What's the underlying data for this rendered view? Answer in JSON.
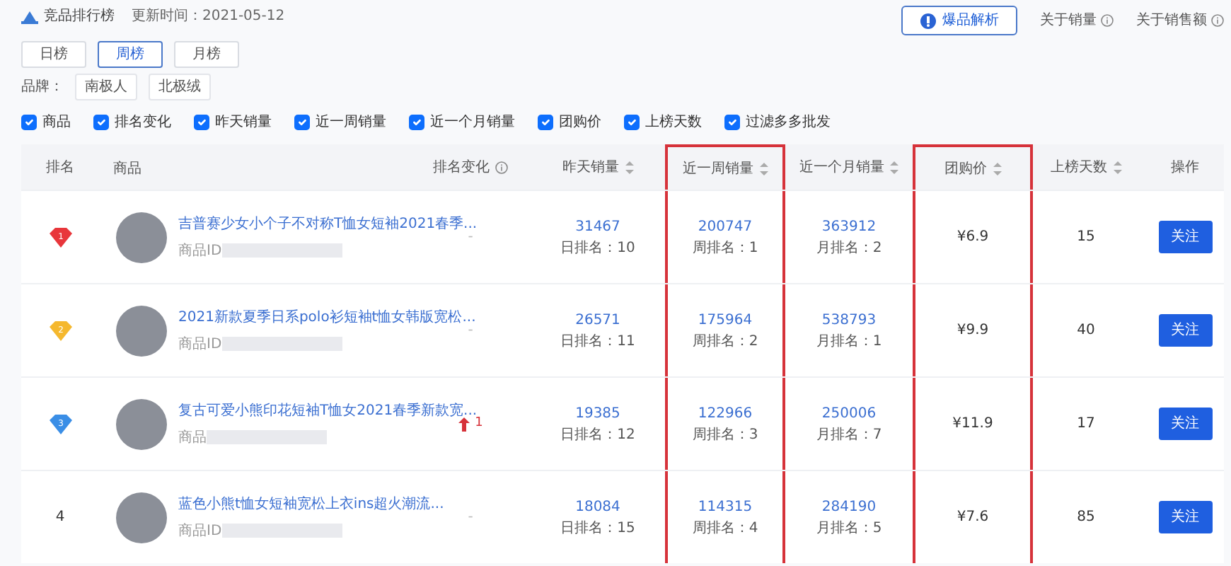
{
  "header": {
    "title": "竞品排行榜",
    "update_time": "更新时间：2021-05-12",
    "analysis_button": "爆品解析",
    "help_links": [
      "关于销量",
      "关于销售额"
    ]
  },
  "period_tabs": [
    {
      "label": "日榜",
      "selected": false
    },
    {
      "label": "周榜",
      "selected": true
    },
    {
      "label": "月榜",
      "selected": false
    }
  ],
  "brand_filter": {
    "label": "品牌：",
    "brands": [
      "南极人",
      "北极绒"
    ]
  },
  "column_toggles": [
    {
      "label": "商品",
      "checked": true
    },
    {
      "label": "排名变化",
      "checked": true
    },
    {
      "label": "昨天销量",
      "checked": true
    },
    {
      "label": "近一周销量",
      "checked": true
    },
    {
      "label": "近一个月销量",
      "checked": true
    },
    {
      "label": "团购价",
      "checked": true
    },
    {
      "label": "上榜天数",
      "checked": true
    },
    {
      "label": "过滤多多批发",
      "checked": true
    }
  ],
  "table": {
    "columns": [
      {
        "label": "排名",
        "sortable": false,
        "info": false,
        "highlighted": false
      },
      {
        "label": "商品",
        "sortable": false,
        "info": false,
        "highlighted": false
      },
      {
        "label": "排名变化",
        "sortable": false,
        "info": true,
        "highlighted": false
      },
      {
        "label": "昨天销量",
        "sortable": true,
        "info": false,
        "highlighted": false
      },
      {
        "label": "近一周销量",
        "sortable": true,
        "info": false,
        "highlighted": true
      },
      {
        "label": "近一个月销量",
        "sortable": true,
        "info": false,
        "highlighted": false
      },
      {
        "label": "团购价",
        "sortable": true,
        "info": false,
        "highlighted": true
      },
      {
        "label": "上榜天数",
        "sortable": true,
        "info": false,
        "highlighted": false
      },
      {
        "label": "操作",
        "sortable": false,
        "info": false,
        "highlighted": false
      }
    ],
    "rows": [
      {
        "rank": {
          "kind": "medal",
          "text": "1",
          "color": "#e8363b"
        },
        "title": "吉普赛少女小个子不对称T恤女短袖2021春季...",
        "store": "商品ID",
        "rank_change": {
          "kind": "none",
          "text": "-"
        },
        "yesterday": "31467",
        "day_rank": "日排名：10",
        "week": "200747",
        "week_rank": "周排名：1",
        "month": "363912",
        "month_rank": "月排名：2",
        "price": "¥6.9",
        "days": "15",
        "action": "关注"
      },
      {
        "rank": {
          "kind": "medal",
          "text": "2",
          "color": "#f5b82e"
        },
        "title": "2021新款夏季日系polo衫短袖t恤女韩版宽松...",
        "store": "商品ID",
        "rank_change": {
          "kind": "none",
          "text": "-"
        },
        "yesterday": "26571",
        "day_rank": "日排名：11",
        "week": "175964",
        "week_rank": "周排名：2",
        "month": "538793",
        "month_rank": "月排名：1",
        "price": "¥9.9",
        "days": "40",
        "action": "关注"
      },
      {
        "rank": {
          "kind": "medal",
          "text": "3",
          "color": "#3a8ee6"
        },
        "title": "复古可爱小熊印花短袖T恤女2021春季新款宽...",
        "store": "商品",
        "rank_change": {
          "kind": "up",
          "text": "1"
        },
        "yesterday": "19385",
        "day_rank": "日排名：12",
        "week": "122966",
        "week_rank": "周排名：3",
        "month": "250006",
        "month_rank": "月排名：7",
        "price": "¥11.9",
        "days": "17",
        "action": "关注"
      },
      {
        "rank": {
          "kind": "number",
          "text": "4"
        },
        "title": "蓝色小熊t恤女短袖宽松上衣ins超火潮流...",
        "store": "商品ID",
        "rank_change": {
          "kind": "none",
          "text": "-"
        },
        "yesterday": "18084",
        "day_rank": "日排名：15",
        "week": "114315",
        "week_rank": "周排名：4",
        "month": "284190",
        "month_rank": "月排名：5",
        "price": "¥7.6",
        "days": "85",
        "action": "关注"
      }
    ]
  }
}
